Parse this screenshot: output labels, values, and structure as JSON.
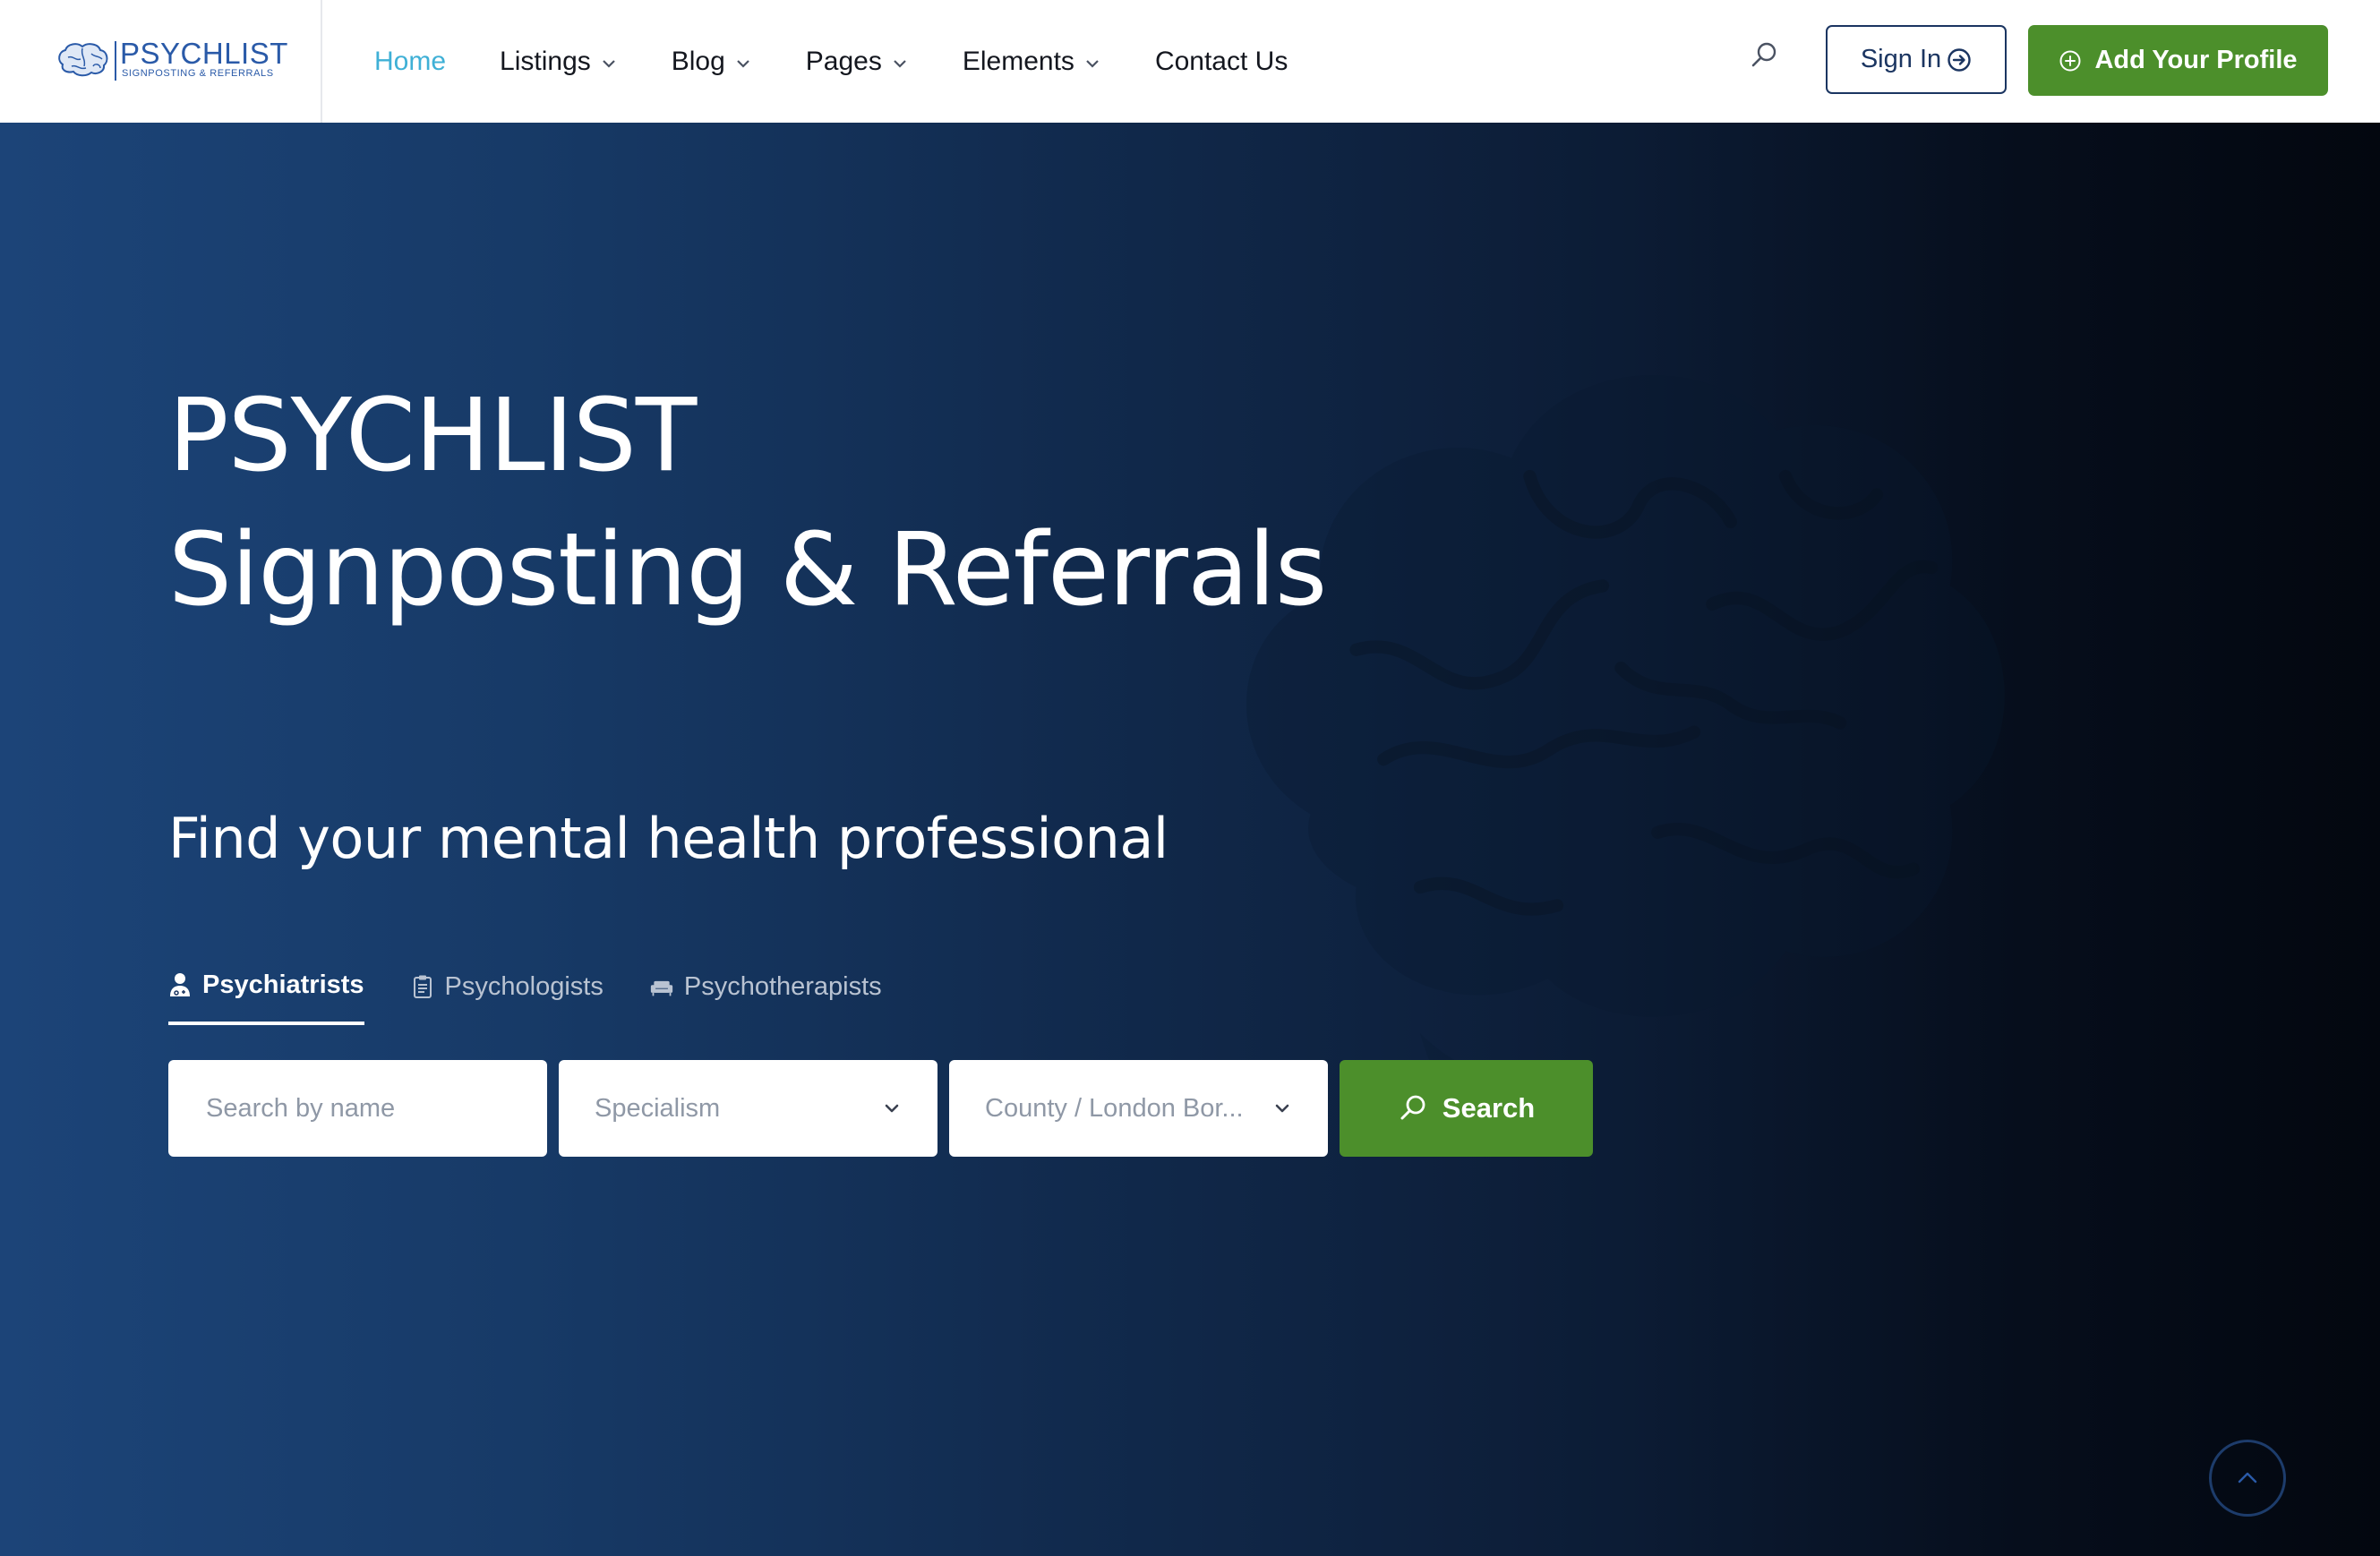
{
  "brand": {
    "name": "PSYCHLIST",
    "tagline": "SIGNPOSTING & REFERRALS",
    "color": "#2a5aa8"
  },
  "nav": {
    "items": [
      {
        "label": "Home",
        "active": true,
        "dropdown": false
      },
      {
        "label": "Listings",
        "dropdown": true
      },
      {
        "label": "Blog",
        "dropdown": true
      },
      {
        "label": "Pages",
        "dropdown": true
      },
      {
        "label": "Elements",
        "dropdown": true
      },
      {
        "label": "Contact Us",
        "dropdown": false
      }
    ],
    "active_color": "#3fb0d6",
    "search_icon": "search-icon",
    "sign_in_label": "Sign In",
    "sign_in_icon": "arrow-circle-right-icon",
    "add_profile_label": "Add Your Profile",
    "add_profile_icon": "plus-circle-icon"
  },
  "hero": {
    "title_line1": "PSYCHLIST",
    "title_line2": "Signposting & Referrals",
    "subtitle": "Find your mental health professional",
    "background_icon": "brain-icon",
    "tabs": [
      {
        "label": "Psychiatrists",
        "icon": "doctor-icon",
        "active": true
      },
      {
        "label": "Psychologists",
        "icon": "clipboard-icon",
        "active": false
      },
      {
        "label": "Psychotherapists",
        "icon": "sofa-icon",
        "active": false
      }
    ],
    "search": {
      "name_placeholder": "Search by name",
      "specialism_value": "Specialism",
      "county_value": "County / London Bor...",
      "button_label": "Search"
    }
  },
  "colors": {
    "accent_green": "#4c8f2b",
    "navy": "#1b3561",
    "hero_start": "#1c4478",
    "hero_end": "#03070f"
  }
}
